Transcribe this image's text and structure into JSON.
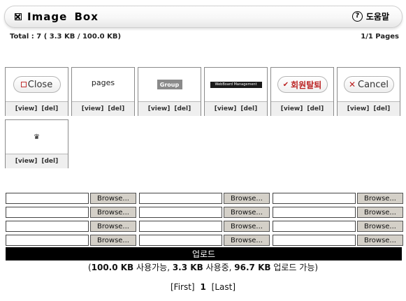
{
  "header": {
    "title": "Image Box",
    "help_label": "도움말",
    "help_icon": "question-circle-icon"
  },
  "summary": {
    "total": "Total : 7 ( 3.3 KB / 100.0 KB)",
    "pages": "1/1 Pages"
  },
  "images": [
    {
      "thumb_text": "Close",
      "view": "[view]",
      "del": "[del]"
    },
    {
      "thumb_text": "pages",
      "view": "[view]",
      "del": "[del]"
    },
    {
      "thumb_text": "Group",
      "view": "[view]",
      "del": "[del]"
    },
    {
      "thumb_text": "WebBoard Management",
      "view": "[view]",
      "del": "[del]"
    },
    {
      "thumb_text": "회원탈퇴",
      "view": "[view]",
      "del": "[del]"
    },
    {
      "thumb_text": "Cancel",
      "view": "[view]",
      "del": "[del]"
    },
    {
      "thumb_text": "",
      "view": "[view]",
      "del": "[del]"
    }
  ],
  "upload": {
    "browse_label": "Browse...",
    "button_label": "업로드",
    "usage_prefix": "(",
    "usage_total": "100.0 KB",
    "usage_total_suffix": " 사용가능, ",
    "usage_used": "3.3 KB",
    "usage_used_suffix": " 사용중, ",
    "usage_free": "96.7 KB",
    "usage_free_suffix": " 업로드 가능)"
  },
  "pager": {
    "first": "[First]",
    "current": "1",
    "last": "[Last]"
  },
  "colors": {
    "upload_bar": "#000000",
    "accent_red": "#b22222"
  }
}
